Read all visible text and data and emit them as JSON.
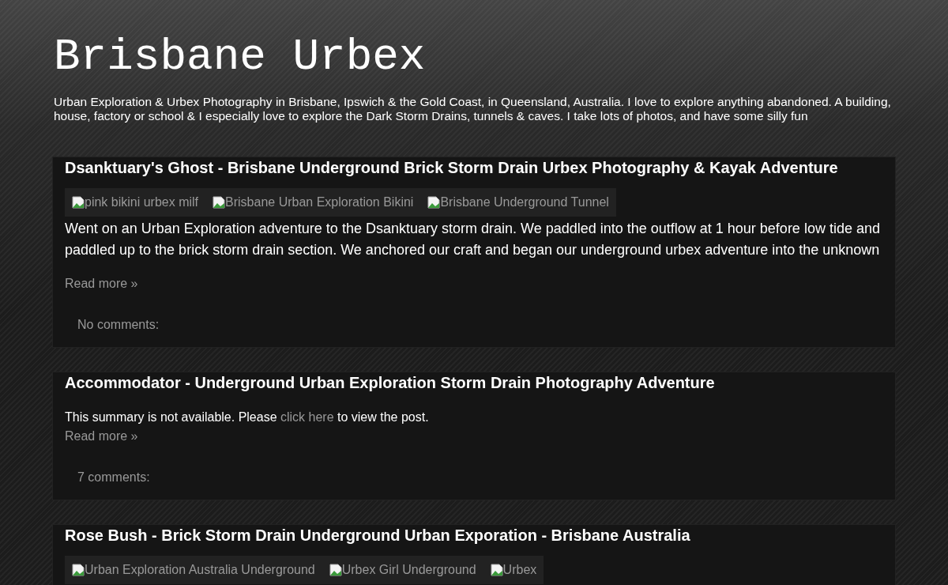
{
  "blog": {
    "title": "Brisbane Urbex",
    "description": "Urban Exploration & Urbex Photography in Brisbane, Ipswich & the Gold Coast, in Queensland, Australia. I love to explore anything abandoned. A building, house, factory or school & I especially love to explore the Dark Storm Drains, tunnels & caves. I take lots of photos, and have some silly fun"
  },
  "posts": [
    {
      "title": "Dsanktuary's Ghost - Brisbane Underground Brick Storm Drain Urbex Photography & Kayak Adventure",
      "images": [
        "pink bikini urbex milf",
        "Brisbane Urban Exploration Bikini",
        "Brisbane Underground Tunnel"
      ],
      "summary": "Went on an Urban Exploration adventure to the Dsanktuary storm drain. We paddled into the outflow at 1 hour before low tide and paddled up to the brick storm drain section. We anchored our craft and began our underground urbex adventure into the unknown",
      "read_more": "Read more »",
      "comments": "No comments:"
    },
    {
      "title": "Accommodator - Underground Urban Exploration Storm Drain Photography Adventure",
      "summary_before": "This summary is not available. Please ",
      "summary_link": "click here",
      "summary_after": " to view the post.",
      "read_more": "Read more »",
      "comments": "7 comments:"
    },
    {
      "title": "Rose Bush - Brick Storm Drain Underground Urban Exporation - Brisbane Australia",
      "images": [
        "Urban Exploration Australia Underground",
        "Urbex Girl Underground",
        "Urbex"
      ]
    }
  ]
}
